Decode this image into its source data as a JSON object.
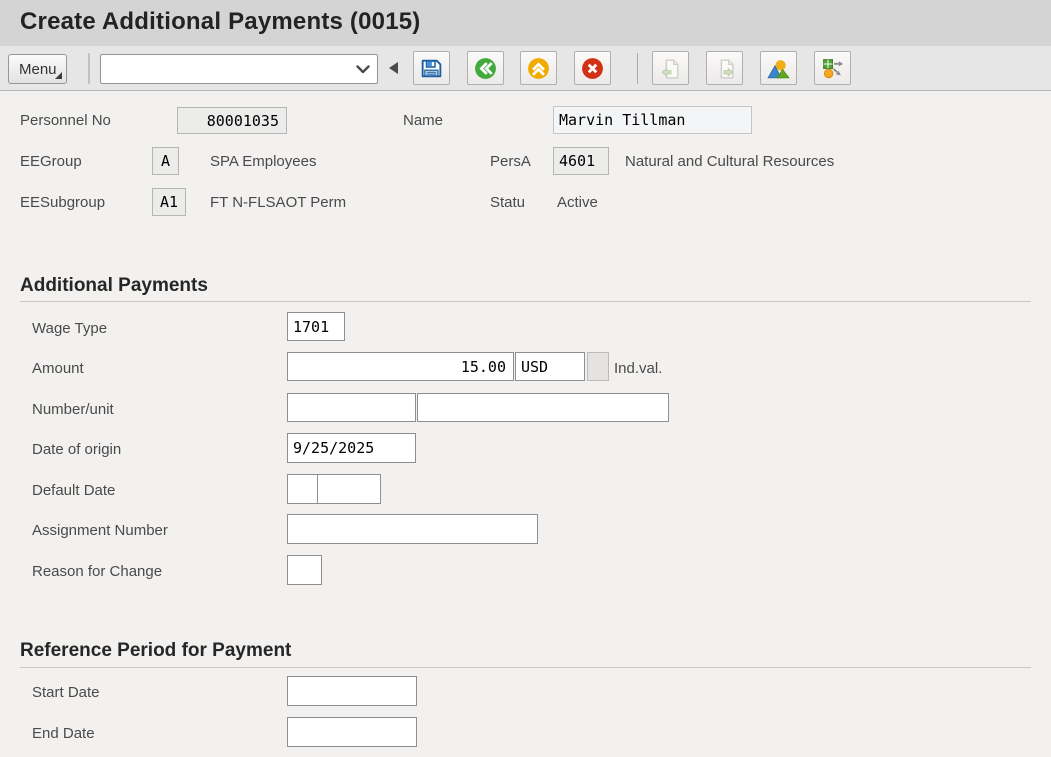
{
  "window": {
    "title": "Create Additional Payments (0015)"
  },
  "toolbar": {
    "menu_label": "Menu",
    "command_field": {
      "value": "",
      "placeholder": ""
    },
    "icons": [
      {
        "name": "save-icon",
        "enabled": true,
        "color": "#3d85c6"
      },
      {
        "name": "back-icon",
        "enabled": true,
        "color": "#44a93d"
      },
      {
        "name": "exit-icon",
        "enabled": true,
        "color": "#f0ab00"
      },
      {
        "name": "cancel-icon",
        "enabled": true,
        "color": "#d23115"
      },
      {
        "name": "previous-record-icon",
        "enabled": false,
        "color": "#c9d8b5"
      },
      {
        "name": "next-record-icon",
        "enabled": false,
        "color": "#c9d8b5"
      },
      {
        "name": "landscape-icon",
        "enabled": true,
        "color": "#3c87c8"
      },
      {
        "name": "distribution-icon",
        "enabled": true,
        "color": "#52a534"
      }
    ]
  },
  "header": {
    "personnel_no": {
      "label": "Personnel No",
      "value": "80001035"
    },
    "name": {
      "label": "Name",
      "value": "Marvin Tillman"
    },
    "ee_group": {
      "label": "EEGroup",
      "value": "A",
      "text": "SPA Employees"
    },
    "pers_a": {
      "label": "PersA",
      "value": "4601",
      "text": "Natural and Cultural Resources"
    },
    "ee_subgroup": {
      "label": "EESubgroup",
      "value": "A1",
      "text": "FT N-FLSAOT Perm"
    },
    "status": {
      "label": "Statu",
      "value": "Active"
    }
  },
  "sections": {
    "additional_payments": {
      "title": "Additional Payments",
      "wage_type": {
        "label": "Wage Type",
        "value": "1701"
      },
      "amount": {
        "label": "Amount",
        "value": "15.00",
        "currency": "USD",
        "indval_label": "Ind.val."
      },
      "number_unit": {
        "label": "Number/unit",
        "number": "",
        "unit": ""
      },
      "date_of_origin": {
        "label": "Date of origin",
        "value": "9/25/2025"
      },
      "default_date": {
        "label": "Default Date",
        "part1": "",
        "part2": ""
      },
      "assignment_number": {
        "label": "Assignment Number",
        "value": ""
      },
      "reason_for_change": {
        "label": "Reason for Change",
        "value": ""
      }
    },
    "reference_period": {
      "title": "Reference Period for Payment",
      "start_date": {
        "label": "Start Date",
        "value": ""
      },
      "end_date": {
        "label": "End Date",
        "value": ""
      }
    }
  }
}
